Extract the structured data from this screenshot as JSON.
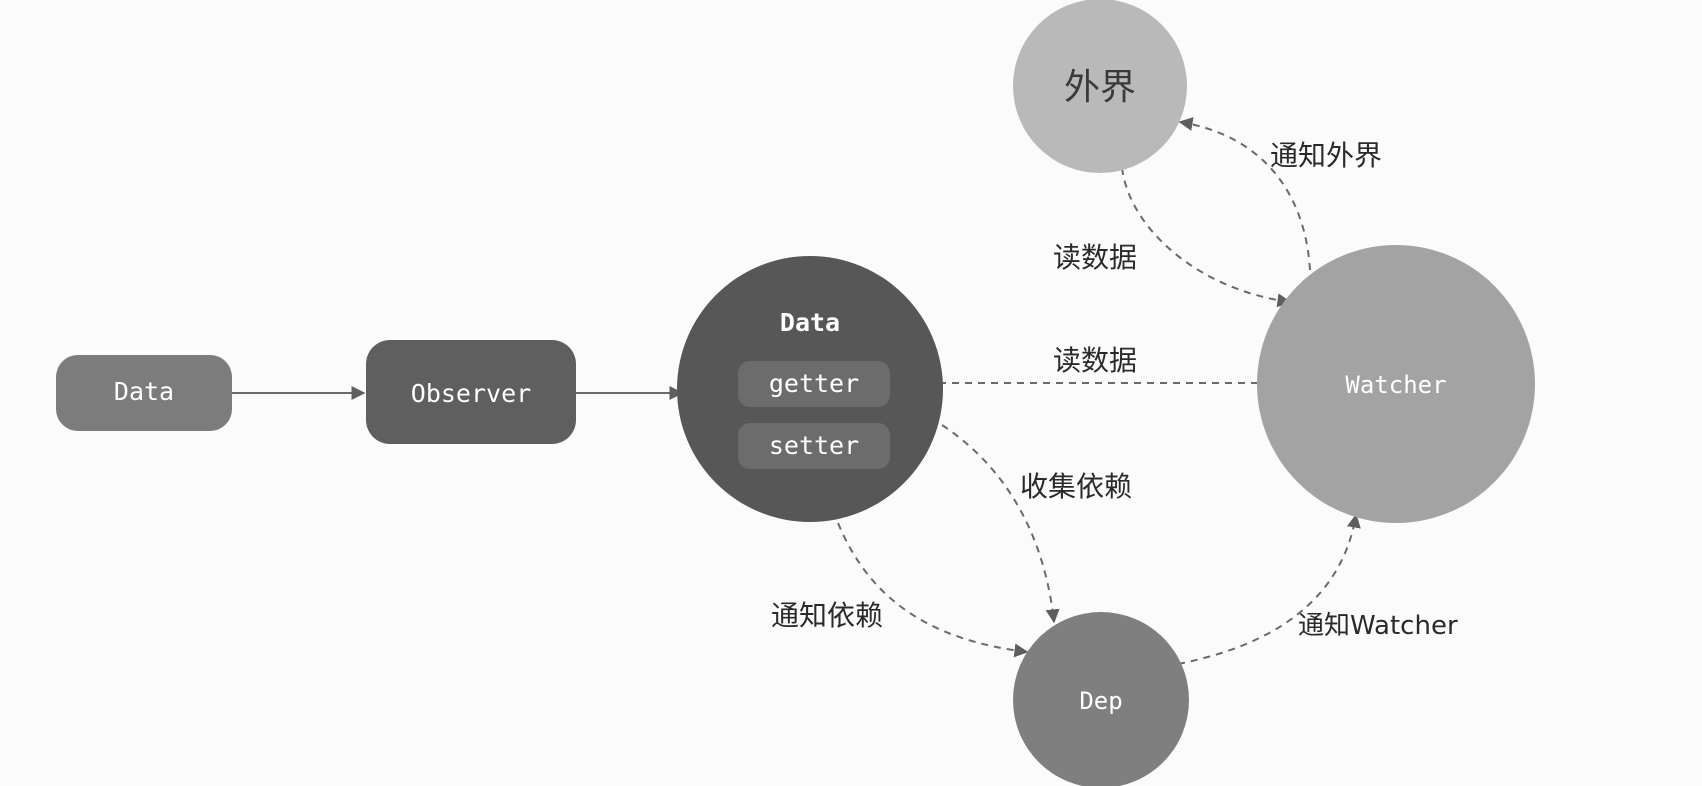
{
  "nodes": {
    "data_source": "Data",
    "observer": "Observer",
    "data_object": {
      "title": "Data",
      "getter": "getter",
      "setter": "setter"
    },
    "outside": "外界",
    "watcher": "Watcher",
    "dep": "Dep"
  },
  "edges": {
    "outside_read": "读数据",
    "notify_outside": "通知外界",
    "watcher_read": "读数据",
    "collect_deps": "收集依赖",
    "notify_deps": "通知依赖",
    "notify_watcher": "通知Watcher"
  },
  "colors": {
    "background": "#fbfbfb",
    "node_medium": "#7c7c7c",
    "node_dark": "#5f5f5f",
    "data_circle": "#575757",
    "getter_setter_pill": "#6c6c6c",
    "outside_circle": "#b9b9b9",
    "watcher_circle": "#a3a3a3",
    "dep_circle": "#7f7f7f",
    "node_text": "#ffffff",
    "label_text": "#2a2a2a",
    "edge_line": "#6a6a6a"
  }
}
